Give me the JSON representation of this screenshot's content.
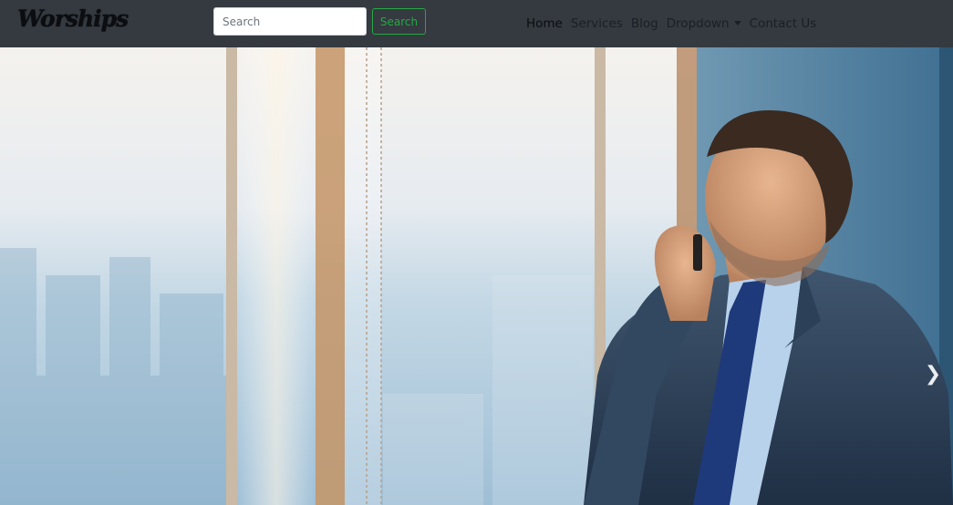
{
  "brand": {
    "name": "Worships"
  },
  "search": {
    "placeholder": "Search",
    "button_label": "Search"
  },
  "nav": {
    "items": [
      {
        "label": "Home",
        "active": true
      },
      {
        "label": "Services"
      },
      {
        "label": "Blog"
      },
      {
        "label": "Dropdown",
        "has_caret": true
      },
      {
        "label": "Contact Us"
      }
    ]
  },
  "hero": {
    "image_alt": "Businessman on phone by office window",
    "next_icon": "chevron-right-icon"
  },
  "colors": {
    "navbar_bg": "#343a40",
    "search_accent": "#28a745"
  }
}
